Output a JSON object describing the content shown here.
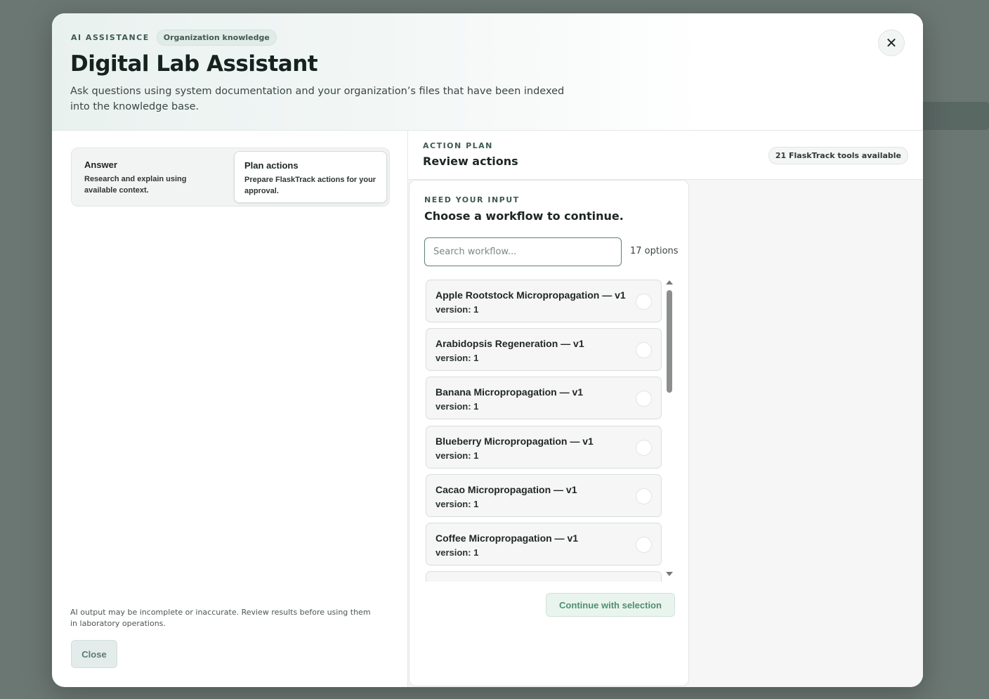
{
  "modal": {
    "eyebrow": "AI ASSISTANCE",
    "badge": "Organization knowledge",
    "title": "Digital Lab Assistant",
    "subtitle": "Ask questions using system documentation and your organization’s files that have been indexed into the knowledge base.",
    "close_icon": "✕"
  },
  "modes": [
    {
      "title": "Answer",
      "description": "Research and explain using available context.",
      "selected": false
    },
    {
      "title": "Plan actions",
      "description": "Prepare FlaskTrack actions for your approval.",
      "selected": true
    }
  ],
  "footer": {
    "disclaimer": "AI output may be incomplete or inaccurate. Review results before using them in laboratory operations.",
    "close_label": "Close"
  },
  "action_plan": {
    "eyebrow": "ACTION PLAN",
    "title": "Review actions",
    "tools_badge": "21 FlaskTrack tools available"
  },
  "input_card": {
    "eyebrow": "NEED YOUR INPUT",
    "title": "Choose a workflow to continue.",
    "search_placeholder": "Search workflow...",
    "options_count": "17 options",
    "continue_label": "Continue with selection",
    "workflows": [
      {
        "name": "Apple Rootstock Micropropagation — v1",
        "version": "version: 1"
      },
      {
        "name": "Arabidopsis Regeneration — v1",
        "version": "version: 1"
      },
      {
        "name": "Banana Micropropagation — v1",
        "version": "version: 1"
      },
      {
        "name": "Blueberry Micropropagation — v1",
        "version": "version: 1"
      },
      {
        "name": "Cacao Micropropagation — v1",
        "version": "version: 1"
      },
      {
        "name": "Coffee Micropropagation — v1",
        "version": "version: 1"
      }
    ]
  }
}
